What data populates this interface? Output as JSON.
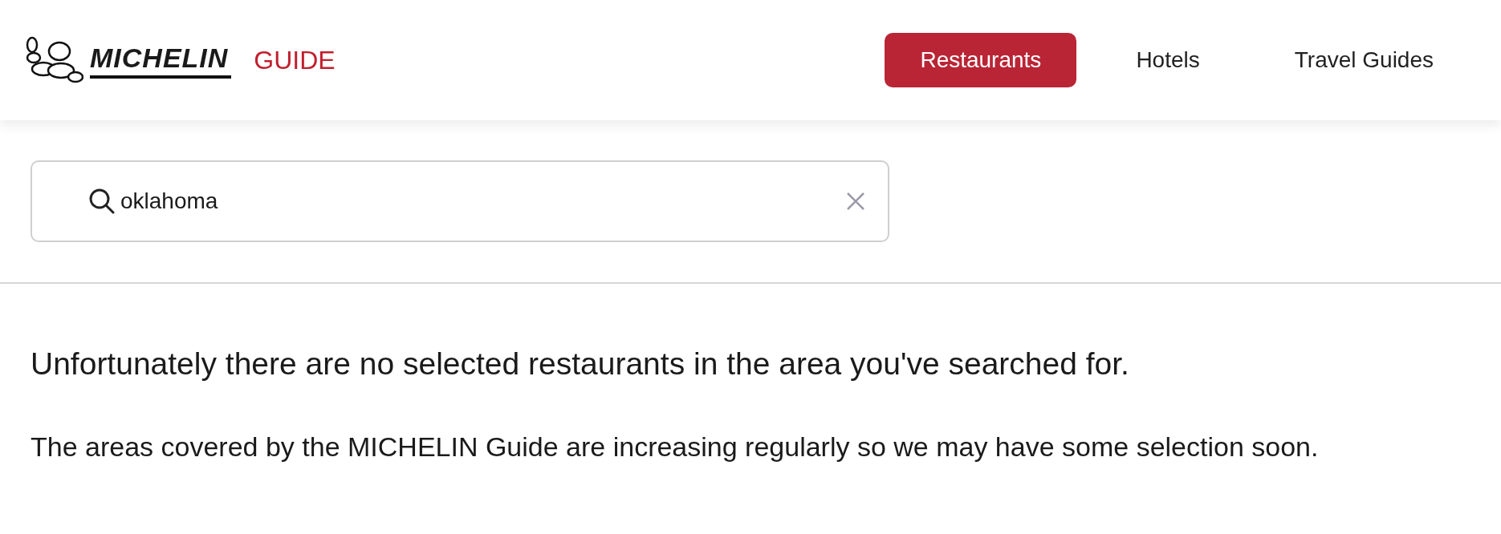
{
  "logo": {
    "wordmark": "MICHELIN",
    "sub": "GUIDE"
  },
  "nav": [
    {
      "label": "Restaurants",
      "selected": true
    },
    {
      "label": "Hotels",
      "selected": false
    },
    {
      "label": "Travel Guides",
      "selected": false
    }
  ],
  "search": {
    "value": "oklahoma"
  },
  "message": {
    "heading": "Unfortunately there are no selected restaurants in the area you've searched for.",
    "body": "The areas covered by the MICHELIN Guide are increasing regularly so we may have some selection soon."
  }
}
